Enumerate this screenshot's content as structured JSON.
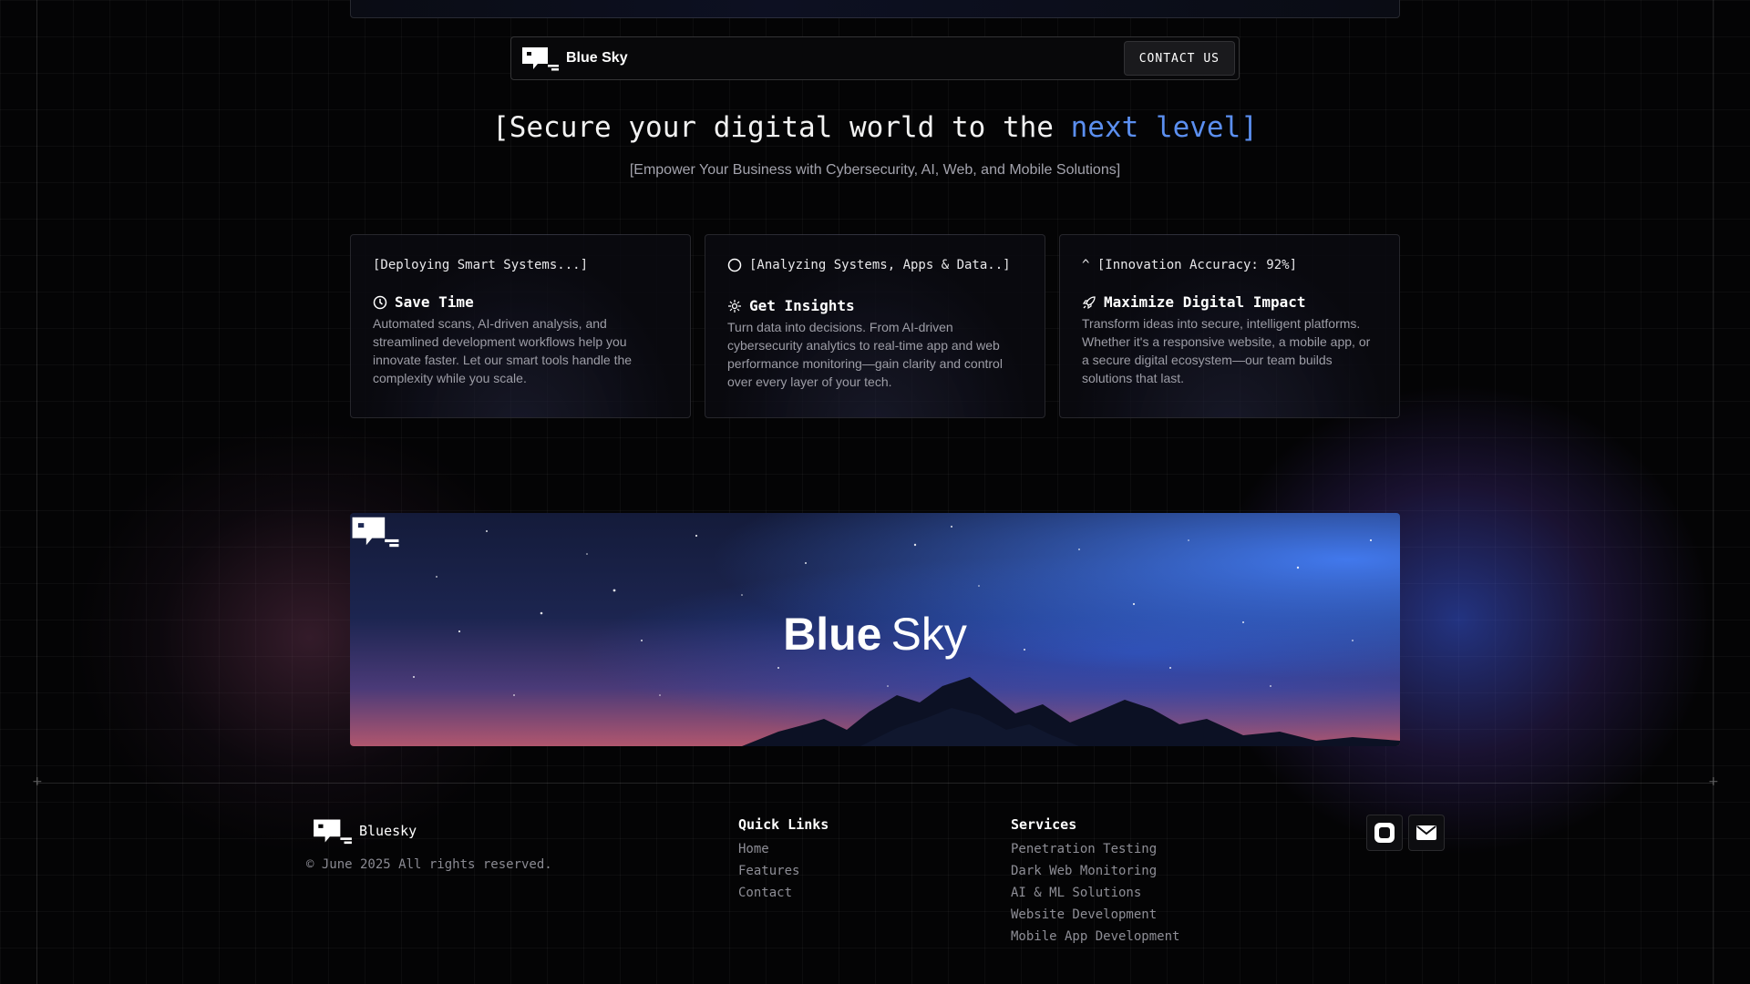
{
  "nav": {
    "brand": "Blue Sky",
    "contact_label": "CONTACT US"
  },
  "hero": {
    "title_prefix": "[Secure your digital world to the ",
    "title_accent": "next level]",
    "subtitle": "[Empower Your Business with Cybersecurity, AI, Web, and Mobile Solutions]"
  },
  "cards": [
    {
      "tag": "[Deploying Smart Systems...]",
      "heading": "Save Time",
      "icon": "clock-icon",
      "body": "Automated scans, AI-driven analysis, and streamlined development workflows help you innovate faster. Let our smart tools handle the complexity while you scale."
    },
    {
      "tag": "[Analyzing Systems, Apps & Data..]",
      "tag_icon": "circle-icon",
      "heading": "Get Insights",
      "icon": "spark-icon",
      "body": "Turn data into decisions. From AI-driven cybersecurity analytics to real-time app and web performance monitoring—gain clarity and control over every layer of your tech."
    },
    {
      "tag": "^ [Innovation Accuracy: 92%]",
      "heading": "Maximize Digital Impact",
      "icon": "rocket-icon",
      "body": "Transform ideas into secure, intelligent platforms. Whether it's a responsive website, a mobile app, or a secure digital ecosystem—our team builds solutions that last."
    }
  ],
  "banner": {
    "word_bold": "Blue",
    "word_light": "Sky"
  },
  "footer": {
    "brand": "Bluesky",
    "copyright": "© June 2025 All rights reserved.",
    "quick_links": {
      "title": "Quick Links",
      "items": [
        "Home",
        "Features",
        "Contact"
      ]
    },
    "services": {
      "title": "Services",
      "items": [
        "Penetration Testing",
        "Dark Web Monitoring",
        "AI & ML Solutions",
        "Website Development",
        "Mobile App Development"
      ]
    },
    "social": [
      "instagram-icon",
      "mail-icon"
    ]
  },
  "colors": {
    "accent": "#5b8ff0",
    "background": "#040405"
  }
}
